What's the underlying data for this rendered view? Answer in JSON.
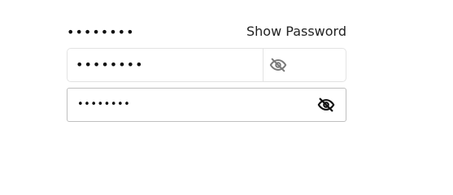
{
  "header": {
    "masked_password": "••••••••",
    "show_password_label": "Show Password"
  },
  "field1": {
    "value": "••••••••",
    "toggle_icon": "eye-slash-icon",
    "icon_color": "#7a7a7a"
  },
  "field2": {
    "value": "••••••••",
    "toggle_icon": "eye-slash-icon",
    "icon_color": "#111111"
  }
}
